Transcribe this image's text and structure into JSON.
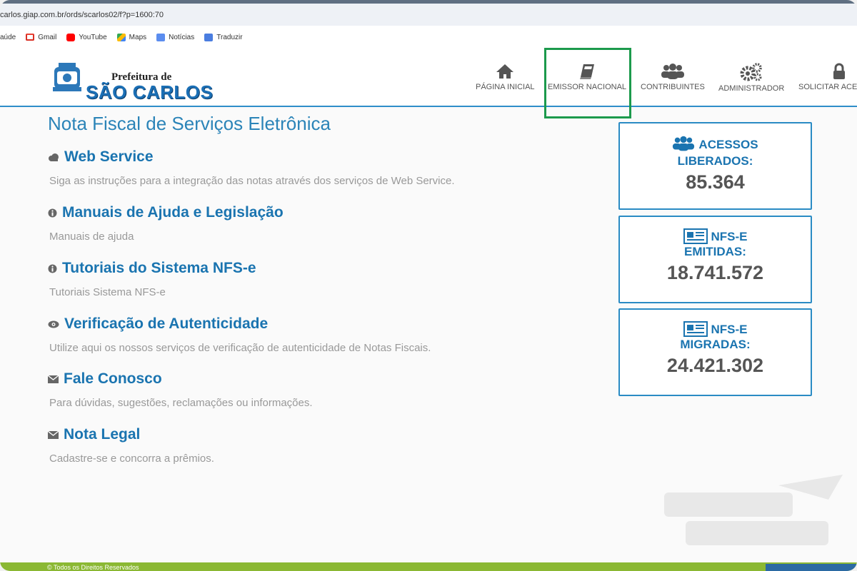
{
  "browser": {
    "url": "carlos.giap.com.br/ords/scarlos02/f?p=1600:70",
    "bookmarks": [
      {
        "label": "aúde",
        "icon": "none"
      },
      {
        "label": "Gmail",
        "icon": "gmail-icon"
      },
      {
        "label": "YouTube",
        "icon": "youtube-icon"
      },
      {
        "label": "Maps",
        "icon": "maps-icon"
      },
      {
        "label": "Notícias",
        "icon": "news-icon"
      },
      {
        "label": "Traduzir",
        "icon": "translate-icon"
      }
    ]
  },
  "header": {
    "logo_line1": "Prefeitura de",
    "logo_line2": "SÃO CARLOS",
    "nav": [
      {
        "label": "PÁGINA INICIAL",
        "icon": "home-icon"
      },
      {
        "label": "EMISSOR NACIONAL",
        "icon": "book-icon"
      },
      {
        "label": "CONTRIBUINTES",
        "icon": "users-icon"
      },
      {
        "label": "ADMINISTRADOR",
        "icon": "gears-icon"
      },
      {
        "label": "SOLICITAR ACESSO",
        "icon": "lock-icon"
      }
    ],
    "accent": "#2f8ec9",
    "highlight_color": "#1c9a4c"
  },
  "main": {
    "title": "Nota Fiscal de Serviços Eletrônica",
    "items": [
      {
        "title": "Web Service",
        "desc": "Siga as instruções para a integração das notas através dos serviços de Web Service.",
        "icon": "cloud-icon"
      },
      {
        "title": "Manuais de Ajuda e Legislação",
        "desc": "Manuais de ajuda",
        "icon": "info-icon"
      },
      {
        "title": "Tutoriais do Sistema NFS-e",
        "desc": "Tutoriais Sistema NFS-e",
        "icon": "info-icon"
      },
      {
        "title": "Verificação de Autenticidade",
        "desc": "Utilize aqui os nossos serviços de verificação de autenticidade de Notas Fiscais.",
        "icon": "eye-icon"
      },
      {
        "title": "Fale Conosco",
        "desc": "Para dúvidas, sugestões, reclamações ou informações.",
        "icon": "envelope-icon"
      },
      {
        "title": "Nota Legal",
        "desc": "Cadastre-se e concorra a prêmios.",
        "icon": "envelope-icon"
      }
    ]
  },
  "stats": [
    {
      "label1": "ACESSOS",
      "label2": "LIBERADOS:",
      "value": "85.364",
      "icon": "users-icon"
    },
    {
      "label1": "NFS-E",
      "label2": "EMITIDAS:",
      "value": "18.741.572",
      "icon": "newspaper-icon"
    },
    {
      "label1": "NFS-E",
      "label2": "MIGRADAS:",
      "value": "24.421.302",
      "icon": "newspaper-icon"
    }
  ],
  "footer": {
    "text": "© Todos os Direitos Reservados",
    "color": "#8bb833"
  }
}
